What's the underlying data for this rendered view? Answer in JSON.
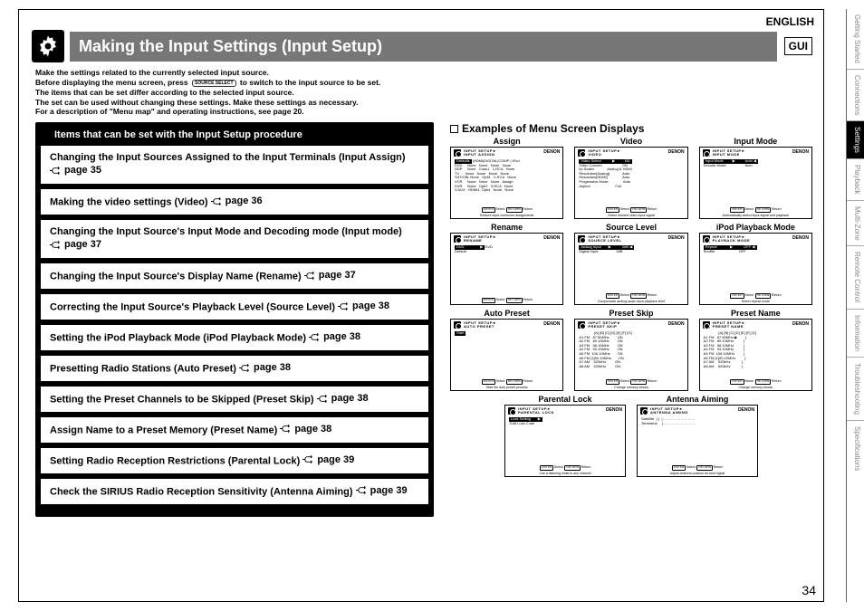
{
  "lang": "ENGLISH",
  "header": {
    "title": "Making the Input Settings (Input Setup)",
    "gui": "GUI"
  },
  "intro": {
    "l1": "Make the settings related to the currently selected input source.",
    "l2a": "Before displaying the menu screen, press",
    "l2b": "to switch to the input source to be set.",
    "srcsel": "SOURCE SELECT",
    "l3": "The items that can be set differ according to the selected input source.",
    "l4": "The set can be used without changing these settings. Make these settings as necessary.",
    "l5": "For a description of \"Menu map\" and operating instructions, see page 20."
  },
  "panel": {
    "head": "Items that can be set with the Input Setup procedure",
    "items": [
      {
        "text": "Changing the Input Sources Assigned to the Input Terminals (Input Assign)",
        "page": "page 35"
      },
      {
        "text": "Making the video settings (Video)",
        "page": "page 36"
      },
      {
        "text": "Changing the Input Source's Input Mode and Decoding mode (Input mode)",
        "page": "page 37"
      },
      {
        "text": "Changing the Input Source's Display Name (Rename)",
        "page": "page 37"
      },
      {
        "text": "Correcting the Input Source's Playback Level (Source Level)",
        "page": "page 38"
      },
      {
        "text": "Setting the iPod Playback Mode (iPod Playback Mode)",
        "page": "page 38"
      },
      {
        "text": "Presetting Radio Stations (Auto Preset)",
        "page": "page 38"
      },
      {
        "text": "Setting the Preset Channels to be Skipped (Preset Skip)",
        "page": "page 38"
      },
      {
        "text": "Assign Name to a Preset Memory (Preset Name)",
        "page": "page 38"
      },
      {
        "text": "Setting Radio Reception Restrictions (Parental Lock)",
        "page": "page 39"
      },
      {
        "text": "Check the SIRIUS Radio Reception Sensitivity (Antenna Aiming)",
        "page": "page 39"
      }
    ]
  },
  "examples": {
    "head": "Examples of Menu Screen Displays",
    "denon": "DENON",
    "screens": [
      {
        "title": "Assign",
        "crumb": "INPUT SETUP►\nINPUT ASSIGN",
        "body_pre": "<span class='inv'>Defaults</span> |HDMI|DIGITAL|COMP | iPod\nDVD     None   None   None   None\nHDP     None   Coax1   1-RCA   None\nTV      None   None   None   None\nSAT/CBL None   Opti1   2-RCA   None\nVCR     None   None   None   Assign\nDVR     None   Opti2   3-RCA   None\nV.AUX   HDMI4  Opti4   None   None",
        "foot_btns": true,
        "hint": "Restore input connector assignments"
      },
      {
        "title": "Video",
        "crumb": "INPUT SETUP►\nVIDEO",
        "body_pre": "<span class='inv'>Video Select           ▶          BD</span>\nVideo Convert                    ON\ni/p Scaler             Analog & HDMI\nResolution[Analog]             Auto\nResolution[HDMI]               Auto\nProgressive Mode               Auto\nAspect                         Full",
        "foot_btns": true,
        "hint": "Select desired video input signal"
      },
      {
        "title": "Input Mode",
        "crumb": "INPUT SETUP►\nINPUT MODE",
        "body_pre": "<span class='inv'>Input Mode         ▶          Auto ◀</span>\nDecode Mode                   Auto",
        "foot_btns": true,
        "hint": "Automatically detect input signal and playback"
      },
      {
        "title": "Rename",
        "crumb": "INPUT SETUP►\nRENAME",
        "body_pre": "<span class='inv'>DVD                ▶</span>DVD\nDefault",
        "foot_btns": true,
        "hint": ""
      },
      {
        "title": "Source Level",
        "crumb": "INPUT SETUP►\nSOURCE LEVEL",
        "body_pre": "<span class='inv'>Analog Input       ▶           0dB ◀</span>\nDigital Input                  0dB",
        "foot_btns": true,
        "hint": "Compensate analog audio input playback level"
      },
      {
        "title": "iPod Playback Mode",
        "crumb": "INPUT SETUP►\nPLAYBACK MODE",
        "body_pre": "<span class='inv'>Repeat             ▶           OFF ◀</span>\nShuffle                        OFF",
        "foot_btns": true,
        "hint": "Select repeat mode"
      },
      {
        "title": "Auto Preset",
        "crumb": "INPUT SETUP►\nAUTO PRESET",
        "body_pre": "<span class='inv'>Start</span>",
        "foot_btns": true,
        "hint": "Start the auto preset process"
      },
      {
        "title": "Preset Skip",
        "crumb": "INPUT SETUP►\nPRESET SKIP",
        "body_pre": "               [A] [B] [C] [D] [E] [F] [G]\nA1 FM   87.50MHz        ON\nA2 FM   89.10MHz        ON\nA3 FM   98.10MHz        ON\nA4 FM   93.10MHz        ON\nA5 FM  106.10MHz       ON\nA6 FM [1]90.10MHz       ON\nA7 AM    520kHz         ON\nA8 AM    520kHz         ON",
        "foot_btns": true,
        "hint": "Change memory blocks"
      },
      {
        "title": "Preset Name",
        "crumb": "INPUT SETUP►\nPRESET NAME",
        "body_pre": "               [A] [B] [C] [D] [E] [F] [G]\nA1 FM   87.50MHz ▶        ]\nA2 FM   89.10MHz          ]\nA3 FM   98.10MHz          ]\nA4 FM   93.10MHz          ]\nA5 FM  106.10MHz         ]\nA6 FM [1]90.10MHz         ]\nA7 AM    520kHz           ]\nA8 AM    520kHz           ]",
        "foot_btns": true,
        "hint": "Change memory blocks"
      },
      {
        "title": "Parental Lock",
        "crumb": "INPUT SETUP►\nPARENTAL LOCK",
        "body_pre": "<span class='inv'>Lock Setting       ▶</span>\n Edit Lock Code",
        "foot_btns": true,
        "hint": "Can a listening limits to any channel"
      },
      {
        "title": "Antenna Aiming",
        "crumb": "INPUT SETUP►\nANTENNA AIMING",
        "body_pre": "Satellite  ) )  |………………………\nTerrestrial     |………………………",
        "foot_btns": true,
        "hint": "Adjust antenna position for best signal"
      }
    ],
    "foot_labels": {
      "enter": "ENTER",
      "select": "Select",
      "return": "RETURN",
      "ret": "Return"
    }
  },
  "side_tabs": [
    {
      "label": "Getting Started",
      "active": false
    },
    {
      "label": "Connections",
      "active": false
    },
    {
      "label": "Settings",
      "active": true
    },
    {
      "label": "Playback",
      "active": false
    },
    {
      "label": "Multi-Zone",
      "active": false
    },
    {
      "label": "Remote Control",
      "active": false
    },
    {
      "label": "Information",
      "active": false
    },
    {
      "label": "Troubleshooting",
      "active": false
    },
    {
      "label": "Specifications",
      "active": false
    }
  ],
  "page_num": "34"
}
